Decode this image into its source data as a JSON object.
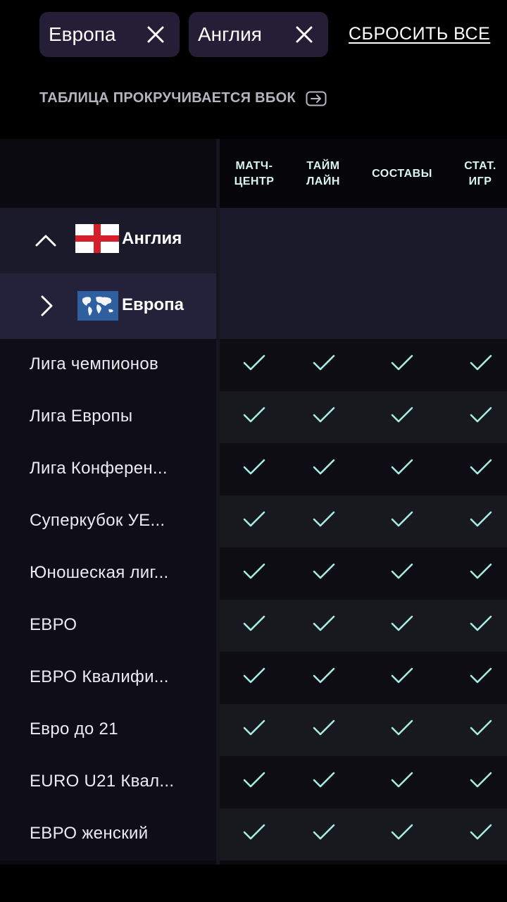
{
  "filters": {
    "chips": [
      {
        "label": "Европа"
      },
      {
        "label": "Англия"
      }
    ],
    "reset_label": "СБРОСИТЬ ВСЕ"
  },
  "hint": {
    "text": "ТАБЛИЦА ПРОКРУЧИВАЕТСЯ ВБОК",
    "icon": "arrow-right-box-icon"
  },
  "table": {
    "columns": [
      {
        "line1": "МАТЧ-",
        "line2": "ЦЕНТР"
      },
      {
        "line1": "ТАЙМ",
        "line2": "ЛАЙН"
      },
      {
        "line1": "СОСТАВЫ",
        "line2": ""
      },
      {
        "line1": "СТАТ.",
        "line2": "ИГР"
      }
    ],
    "groups": [
      {
        "name": "Англия",
        "expanded": true,
        "flag": "england-flag"
      },
      {
        "name": "Европа",
        "expanded": false,
        "flag": "world-map-flag"
      }
    ],
    "rows": [
      {
        "name": "Лига чемпионов",
        "values": [
          true,
          true,
          true,
          true
        ]
      },
      {
        "name": "Лига Европы",
        "values": [
          true,
          true,
          true,
          true
        ]
      },
      {
        "name": "Лига Конферен...",
        "values": [
          true,
          true,
          true,
          true
        ]
      },
      {
        "name": "Суперкубок УЕ...",
        "values": [
          true,
          true,
          true,
          true
        ]
      },
      {
        "name": "Юношеская лиг...",
        "values": [
          true,
          true,
          true,
          true
        ]
      },
      {
        "name": "ЕВРО",
        "values": [
          true,
          true,
          true,
          true
        ]
      },
      {
        "name": "ЕВРО Квалифи...",
        "values": [
          true,
          true,
          true,
          true
        ]
      },
      {
        "name": "Евро до 21",
        "values": [
          true,
          true,
          true,
          true
        ]
      },
      {
        "name": "EURO U21 Квал...",
        "values": [
          true,
          true,
          true,
          true
        ]
      },
      {
        "name": "ЕВРО женский",
        "values": [
          true,
          true,
          true,
          true
        ]
      }
    ]
  },
  "colors": {
    "check": "#a6ece0",
    "chip_bg": "#241e36",
    "group_bg": "#1b1a2a"
  }
}
